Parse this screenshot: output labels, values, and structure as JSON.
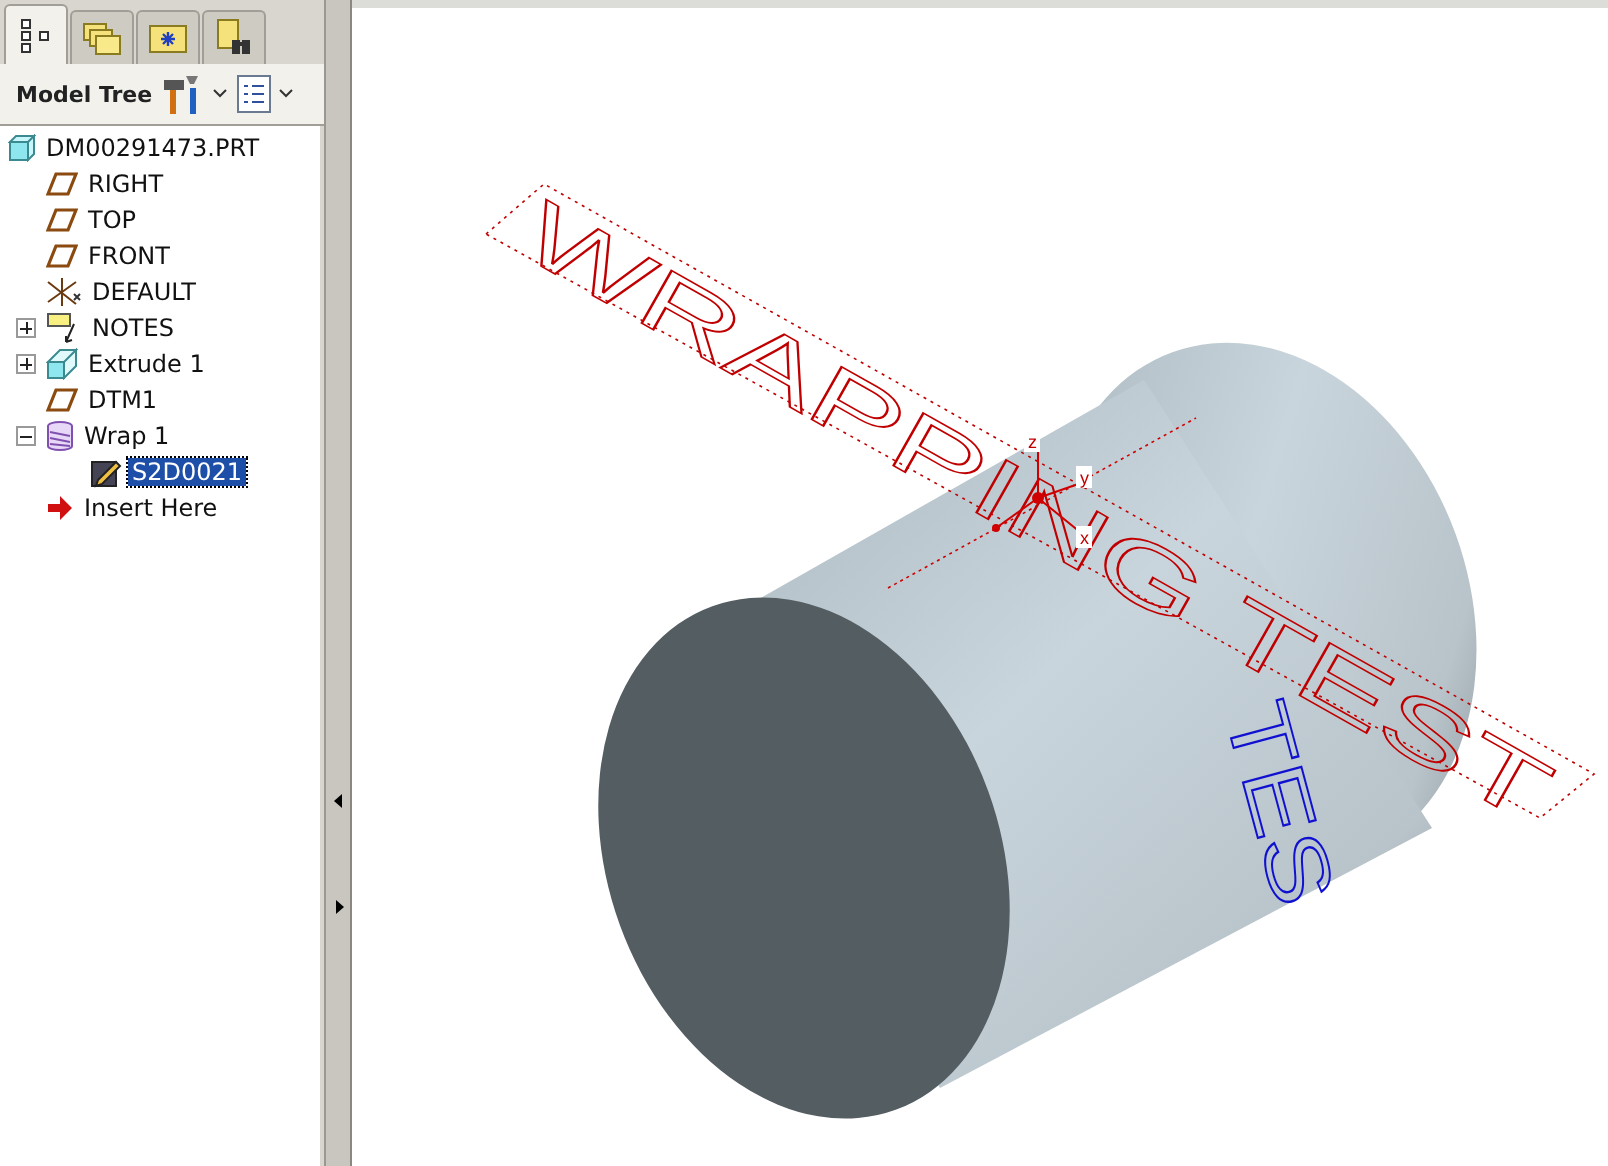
{
  "tabs": [
    {
      "kind": "tree",
      "selected": true
    },
    {
      "kind": "folders",
      "selected": false
    },
    {
      "kind": "favorites",
      "selected": false
    },
    {
      "kind": "search",
      "selected": false
    }
  ],
  "toolbar": {
    "title": "Model Tree"
  },
  "tree": [
    {
      "label": "DM00291473.PRT",
      "kind": "part",
      "selected": false,
      "children": [
        {
          "label": "RIGHT",
          "kind": "plane",
          "selected": false
        },
        {
          "label": "TOP",
          "kind": "plane",
          "selected": false
        },
        {
          "label": "FRONT",
          "kind": "plane",
          "selected": false
        },
        {
          "label": "DEFAULT",
          "kind": "csys",
          "selected": false
        },
        {
          "label": "NOTES",
          "kind": "notes",
          "selected": false,
          "expanded": false
        },
        {
          "label": "Extrude 1",
          "kind": "extrude",
          "selected": false,
          "expanded": false
        },
        {
          "label": "DTM1",
          "kind": "plane",
          "selected": false
        },
        {
          "label": "Wrap 1",
          "kind": "wrap",
          "selected": false,
          "expanded": true,
          "children": [
            {
              "label": "S2D0021",
              "kind": "sketch",
              "selected": true
            }
          ]
        },
        {
          "label": "Insert Here",
          "kind": "insert",
          "selected": false
        }
      ]
    }
  ],
  "viewport": {
    "sketch_text": "WRAPPING TEST",
    "wrapped_text": "TES",
    "axis_labels": [
      "z",
      "y",
      "x"
    ]
  }
}
